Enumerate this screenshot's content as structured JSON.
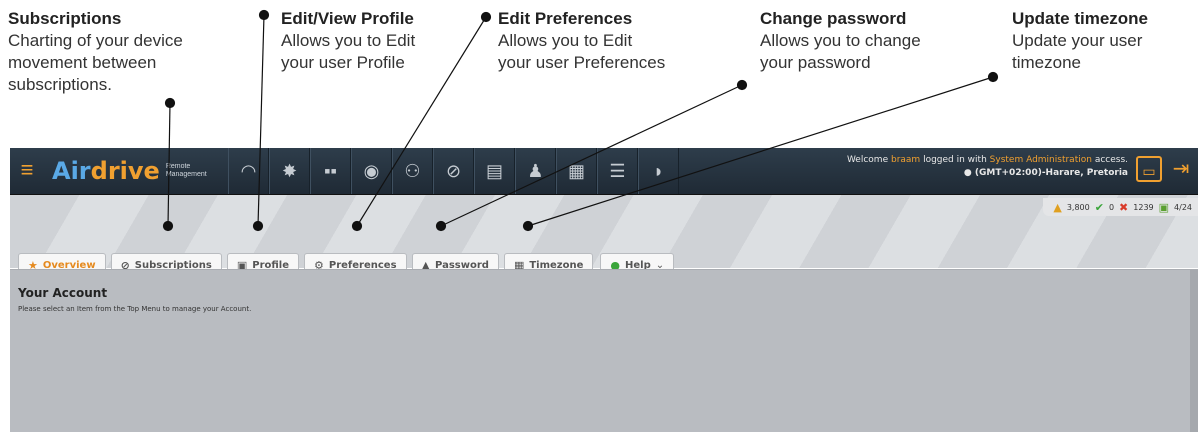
{
  "callouts": [
    {
      "title": "Subscriptions",
      "lines": [
        "Charting of your device",
        "movement between",
        "subscriptions."
      ]
    },
    {
      "title": "Edit/View Profile",
      "lines": [
        "Allows you to Edit",
        "your user Profile"
      ]
    },
    {
      "title": "Edit Preferences",
      "lines": [
        "Allows you to Edit",
        "your user Preferences"
      ]
    },
    {
      "title": "Change password",
      "lines": [
        "Allows you to change",
        "your password"
      ]
    },
    {
      "title": "Update timezone",
      "lines": [
        "Update your user",
        "timezone"
      ]
    }
  ],
  "header": {
    "logo_air": "Air",
    "logo_drive": "drive",
    "logo_sub_1": "Remote",
    "logo_sub_2": "Management",
    "welcome_prefix": "Welcome",
    "username": "braam",
    "welcome_mid": "logged in with",
    "access": "System Administration",
    "welcome_suffix": "access.",
    "timezone": "(GMT+02:00)-Harare, Pretoria",
    "nav_icons": [
      "speedometer-icon",
      "bug-icon",
      "apps-icon",
      "eye-icon",
      "sitemap-icon",
      "subscription-icon",
      "document-icon",
      "users-icon",
      "book-icon",
      "list-icon",
      "bell-icon"
    ]
  },
  "stats": {
    "coins": "3,800",
    "ok": "0",
    "failed": "1239",
    "ratio": "4/24"
  },
  "tabs": [
    {
      "label": "Overview",
      "active": true
    },
    {
      "label": "Subscriptions"
    },
    {
      "label": "Profile"
    },
    {
      "label": "Preferences"
    },
    {
      "label": "Password"
    },
    {
      "label": "Timezone"
    },
    {
      "label": "Help"
    }
  ],
  "content": {
    "title": "Your Account",
    "text": "Please select an Item from the Top Menu to manage your Account."
  },
  "colors": {
    "accent": "#f0a030",
    "header_bg": "#2e3d4b",
    "content_bg": "#b9bcc1"
  }
}
